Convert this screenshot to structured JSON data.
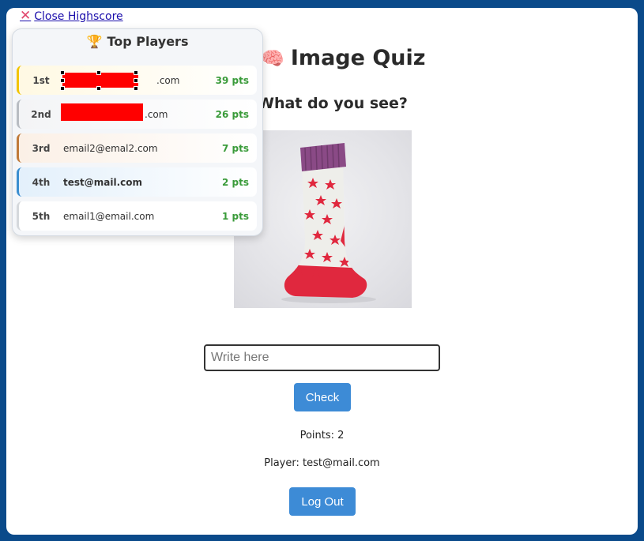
{
  "header": {
    "close_label": "Close Highscore",
    "close_icon": "close-x-icon"
  },
  "highscore": {
    "title": "Top Players",
    "trophy_icon": "trophy-icon",
    "rows": [
      {
        "rank": "1st",
        "email": ".com",
        "points": "39 pts"
      },
      {
        "rank": "2nd",
        "email": ".com",
        "points": "26 pts"
      },
      {
        "rank": "3rd",
        "email": "email2@emal2.com",
        "points": "7 pts"
      },
      {
        "rank": "4th",
        "email": "test@mail.com",
        "points": "2 pts"
      },
      {
        "rank": "5th",
        "email": "email1@email.com",
        "points": "1 pts"
      }
    ]
  },
  "quiz": {
    "title": "Image Quiz",
    "title_icon": "brain-icon",
    "question": "What do you see?",
    "answer_placeholder": "Write here",
    "check_label": "Check",
    "points_text": "Points: 2",
    "player_text": "Player: test@mail.com",
    "logout_label": "Log Out"
  },
  "colors": {
    "background": "#0a4a8a",
    "button": "#3d8bd6",
    "points_green": "#3a9b3a",
    "redaction": "#ff0000"
  }
}
